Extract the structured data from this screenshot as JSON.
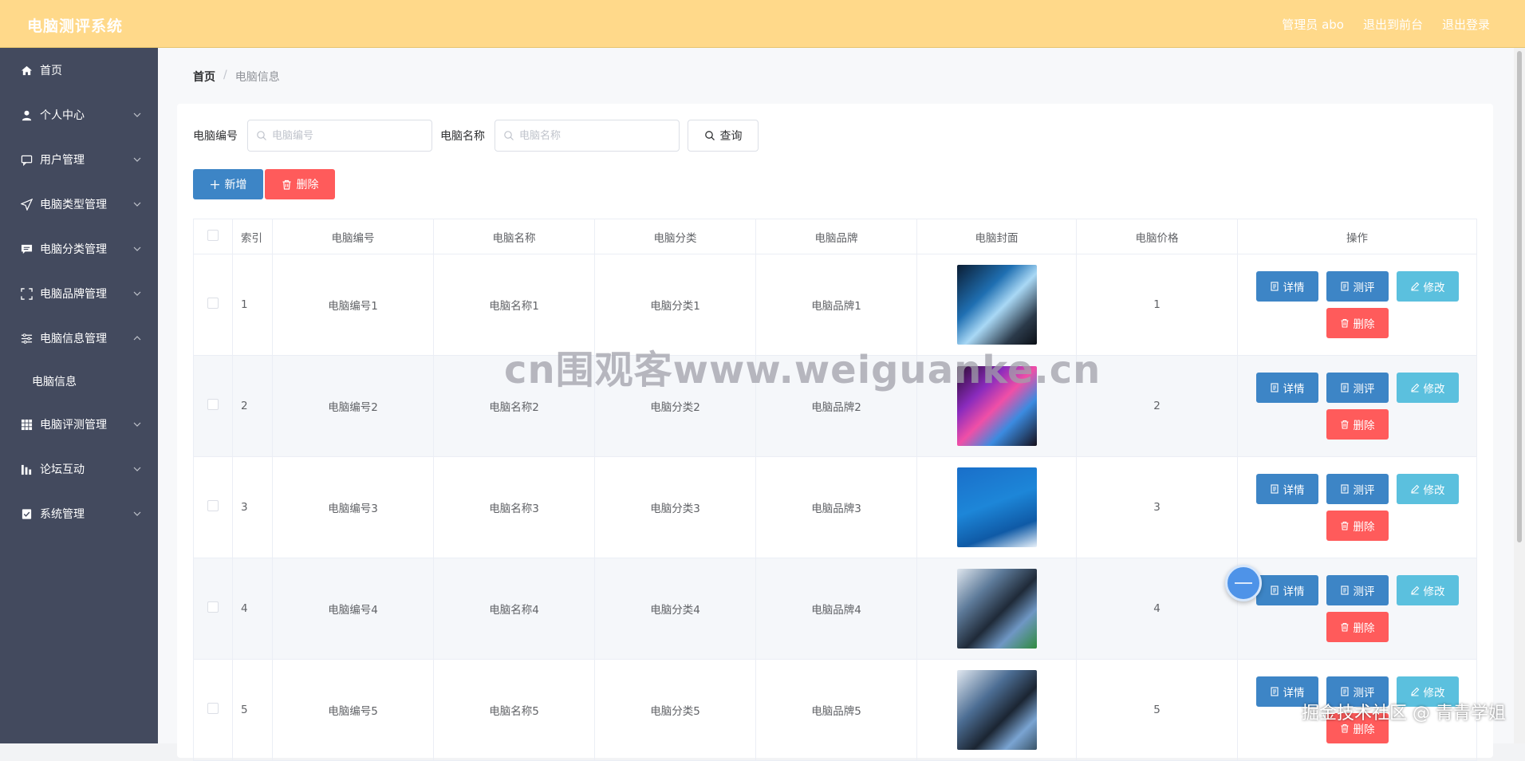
{
  "header": {
    "title": "电脑测评系统",
    "admin_label": "管理员 abo",
    "exit_frontend": "退出到前台",
    "logout": "退出登录",
    "bg_color": "#ffd98a"
  },
  "sidebar": {
    "items": [
      {
        "label": "首页",
        "icon": "home-icon"
      },
      {
        "label": "个人中心",
        "icon": "user-icon"
      },
      {
        "label": "用户管理",
        "icon": "chat-icon"
      },
      {
        "label": "电脑类型管理",
        "icon": "send-icon"
      },
      {
        "label": "电脑分类管理",
        "icon": "message-icon"
      },
      {
        "label": "电脑品牌管理",
        "icon": "fullscreen-icon"
      },
      {
        "label": "电脑信息管理",
        "icon": "sliders-icon"
      },
      {
        "label": "电脑评测管理",
        "icon": "grid-icon"
      },
      {
        "label": "论坛互动",
        "icon": "chart-icon"
      },
      {
        "label": "系统管理",
        "icon": "checklist-icon"
      }
    ],
    "sub_item": "电脑信息",
    "bg_color": "#434a5e"
  },
  "breadcrumb": {
    "home": "首页",
    "separator": "/",
    "current": "电脑信息"
  },
  "search": {
    "code_label": "电脑编号",
    "code_placeholder": "电脑编号",
    "name_label": "电脑名称",
    "name_placeholder": "电脑名称",
    "query_button": "查询"
  },
  "toolbar": {
    "add_label": "新增",
    "delete_label": "删除"
  },
  "table": {
    "headers": [
      "索引",
      "电脑编号",
      "电脑名称",
      "电脑分类",
      "电脑品牌",
      "电脑封面",
      "电脑价格",
      "操作"
    ],
    "rows": [
      {
        "index": "1",
        "code": "电脑编号1",
        "name": "电脑名称1",
        "category": "电脑分类1",
        "brand": "电脑品牌1",
        "price": "1"
      },
      {
        "index": "2",
        "code": "电脑编号2",
        "name": "电脑名称2",
        "category": "电脑分类2",
        "brand": "电脑品牌2",
        "price": "2"
      },
      {
        "index": "3",
        "code": "电脑编号3",
        "name": "电脑名称3",
        "category": "电脑分类3",
        "brand": "电脑品牌3",
        "price": "3"
      },
      {
        "index": "4",
        "code": "电脑编号4",
        "name": "电脑名称4",
        "category": "电脑分类4",
        "brand": "电脑品牌4",
        "price": "4"
      },
      {
        "index": "5",
        "code": "电脑编号5",
        "name": "电脑名称5",
        "category": "电脑分类5",
        "brand": "电脑品牌5",
        "price": "5"
      }
    ],
    "ops": {
      "detail": "详情",
      "review": "测评",
      "edit": "修改",
      "delete": "删除"
    }
  },
  "watermark": "cn围观客www.weiguanke.cn",
  "footer_mark": "掘金技术社区 @ 青青学姐"
}
